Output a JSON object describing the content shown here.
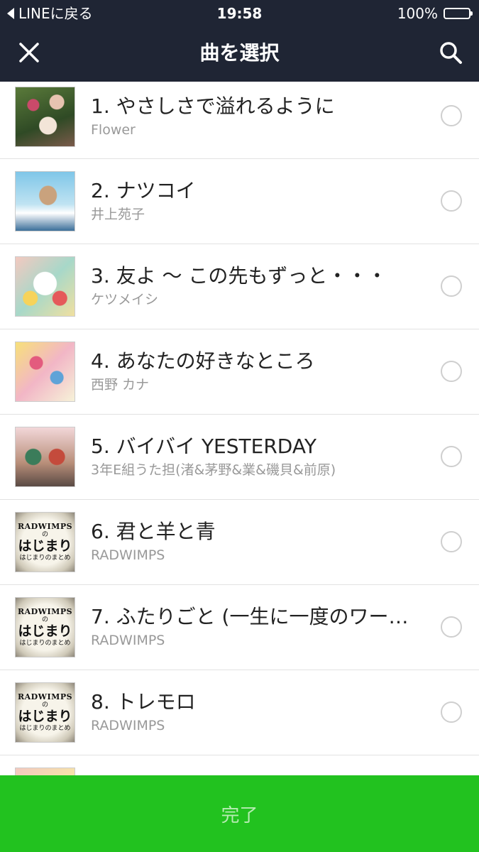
{
  "status_bar": {
    "back_label": "LINEに戻る",
    "time": "19:58",
    "battery": "100%",
    "battery_level": 1.0
  },
  "header": {
    "title": "曲を選択",
    "close_icon": "close-icon",
    "search_icon": "search-icon"
  },
  "songs": [
    {
      "title": "1. やさしさで溢れるように",
      "artist": "Flower",
      "selected": false
    },
    {
      "title": "2. ナツコイ",
      "artist": "井上苑子",
      "selected": false
    },
    {
      "title": "3. 友よ 〜 この先もずっと・・・",
      "artist": "ケツメイシ",
      "selected": false
    },
    {
      "title": "4. あなたの好きなところ",
      "artist": "西野 カナ",
      "selected": false
    },
    {
      "title": "5. バイバイ YESTERDAY",
      "artist": "3年E組うた担(渚&茅野&業&磯貝&前原)",
      "selected": false
    },
    {
      "title": "6. 君と羊と青",
      "artist": "RADWIMPS",
      "selected": false
    },
    {
      "title": "7. ふたりごと (一生に一度のワー…",
      "artist": "RADWIMPS",
      "selected": false
    },
    {
      "title": "8. トレモロ",
      "artist": "RADWIMPS",
      "selected": false
    }
  ],
  "album_art_text": {
    "line1": "RADWIMPS",
    "line2": "の",
    "line3": "はじまり",
    "line4": "はじまりのまとめ"
  },
  "footer": {
    "done_label": "完了"
  },
  "colors": {
    "header_bg": "#1f2534",
    "done_bg": "#22c21f",
    "done_text": "#b6ecb2"
  }
}
